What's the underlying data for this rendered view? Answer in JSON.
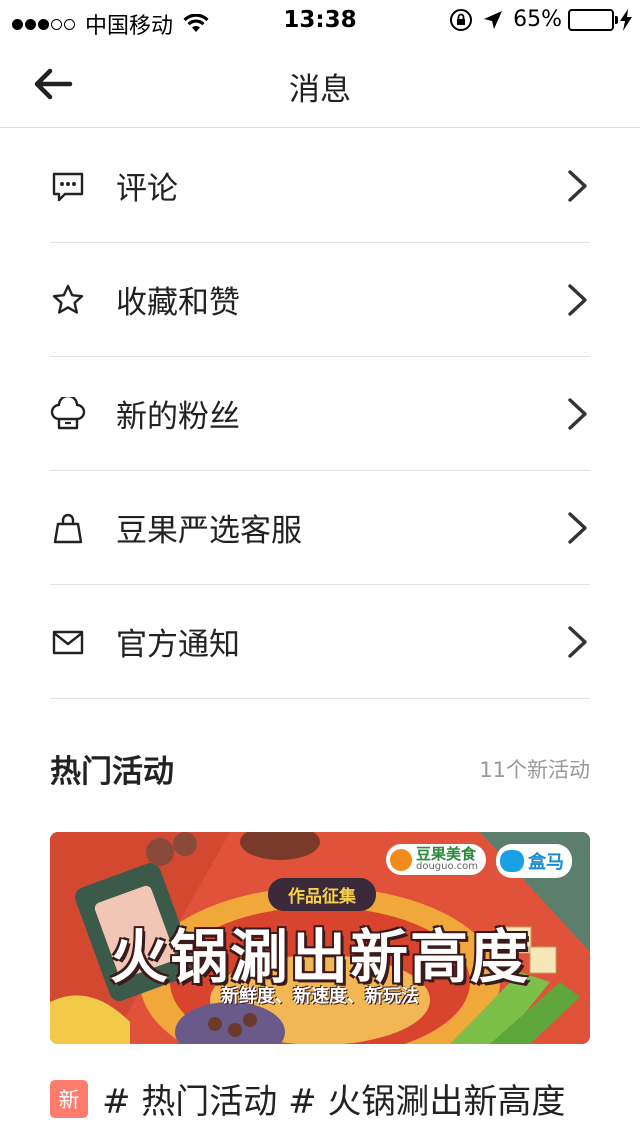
{
  "status_bar": {
    "carrier": "中国移动",
    "time": "13:38",
    "battery": "65%",
    "battery_level": 0.65,
    "signal_bars_filled": 3,
    "signal_bars_total": 5
  },
  "nav": {
    "title": "消息"
  },
  "menu": {
    "items": [
      {
        "label": "评论",
        "icon": "comment-icon"
      },
      {
        "label": "收藏和赞",
        "icon": "star-icon"
      },
      {
        "label": "新的粉丝",
        "icon": "chef-hat-icon"
      },
      {
        "label": "豆果严选客服",
        "icon": "shopping-bag-icon"
      },
      {
        "label": "官方通知",
        "icon": "mail-icon"
      }
    ]
  },
  "hot": {
    "title": "热门活动",
    "count_text": "11个新活动",
    "banner": {
      "tag": "作品征集",
      "headline": "火锅涮出新高度",
      "subline": "新鲜度、新速度、新玩法",
      "brand1": "豆果美食",
      "brand1_url": "douguo.com",
      "brand2": "盒马"
    },
    "activity": {
      "badge": "新",
      "text": "# 热门活动 # 火锅涮出新高度"
    }
  },
  "colors": {
    "battery_green": "#4cd964",
    "badge": "#ff7b6b",
    "banner_bg": "#e0533a"
  }
}
